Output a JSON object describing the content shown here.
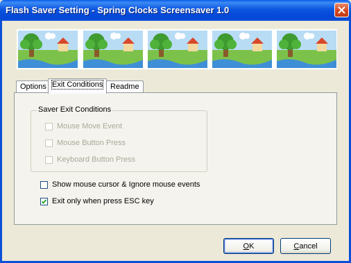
{
  "window": {
    "title": "Flash Saver Setting - Spring Clocks Screensaver 1.0",
    "close_icon": "close-icon"
  },
  "banner": {
    "thumbnails": [
      "scene-thumbnail",
      "scene-thumbnail",
      "scene-thumbnail",
      "scene-thumbnail",
      "scene-thumbnail"
    ]
  },
  "tabs": [
    {
      "label": "Options",
      "active": false
    },
    {
      "label": "Exit Conditions",
      "active": true
    },
    {
      "label": "Readme",
      "active": false
    }
  ],
  "exit_conditions": {
    "group_title": "Saver Exit Conditions",
    "options": [
      {
        "label": "Mouse Move Event",
        "checked": false,
        "enabled": false
      },
      {
        "label": "Mouse Button Press",
        "checked": false,
        "enabled": false
      },
      {
        "label": "Keyboard Button Press",
        "checked": false,
        "enabled": false
      }
    ],
    "show_cursor": {
      "label": "Show mouse cursor & Ignore mouse events",
      "checked": false
    },
    "esc_only": {
      "label": "Exit only when press ESC key",
      "checked": true
    }
  },
  "buttons": {
    "ok_label": "OK",
    "ok_mnemonic": "O",
    "cancel_label": "Cancel",
    "cancel_mnemonic": "C"
  },
  "colors": {
    "titlebar": "#0a4fd8",
    "dialog_bg": "#ece9d8",
    "close_button": "#d6451d"
  }
}
